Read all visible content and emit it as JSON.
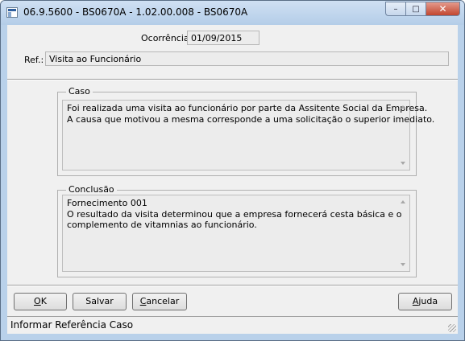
{
  "window": {
    "title": "06.9.5600 - BS0670A - 1.02.00.008 - BS0670A",
    "controls": {
      "minimize": "–",
      "maximize": "□",
      "close": "✕"
    }
  },
  "header": {
    "ocorrencia_label": "Ocorrência:",
    "ocorrencia_value": "01/09/2015",
    "ref_label": "Ref.:",
    "ref_value": "Visita ao Funcionário"
  },
  "caso": {
    "label": "Caso",
    "lines": [
      "Foi realizada uma visita ao funcionário por parte da Assitente Social da Empresa.",
      "A causa que motivou a mesma corresponde a uma solicitação o superior imediato."
    ]
  },
  "conclusao": {
    "label": "Conclusão",
    "lines": [
      "Fornecimento 001",
      "O resultado da visita determinou que a empresa fornecerá cesta básica e o",
      "complemento de vitamnias ao funcionário."
    ]
  },
  "buttons": {
    "ok": {
      "mnemonic": "O",
      "rest": "K"
    },
    "salvar": {
      "mnemonic": "",
      "rest": "Salvar"
    },
    "cancelar": {
      "mnemonic": "C",
      "rest": "ancelar"
    },
    "ajuda": {
      "mnemonic": "A",
      "rest": "juda"
    }
  },
  "status": {
    "text": "Informar Referência Caso"
  }
}
